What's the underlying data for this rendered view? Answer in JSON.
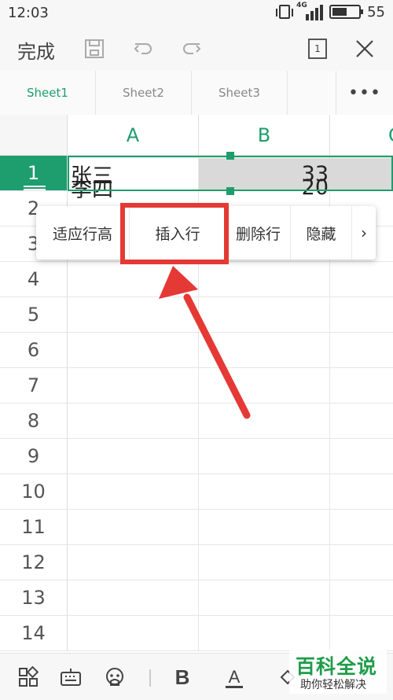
{
  "status_bar": {
    "time": "12:03",
    "network": "4G",
    "battery": "55",
    "battery_level": 0.55
  },
  "toolbar": {
    "done_label": "完成",
    "pages_count": "1"
  },
  "sheet_tabs": [
    "Sheet1",
    "Sheet2",
    "Sheet3"
  ],
  "more_tabs_label": "•••",
  "columns": [
    "A",
    "B",
    "C"
  ],
  "rows": [
    "1",
    "2",
    "3",
    "4",
    "5",
    "6",
    "7",
    "8",
    "9",
    "10",
    "11",
    "12",
    "13",
    "14"
  ],
  "cells": {
    "A1": "张三",
    "B1": "33",
    "A2": "李四",
    "B2": "20"
  },
  "context_menu": {
    "items": [
      "适应行高",
      "插入行",
      "删除行",
      "隐藏"
    ],
    "more_label": "›"
  },
  "colors": {
    "accent": "#1e9d6e",
    "highlight": "#e53935"
  },
  "watermark": {
    "title": "百科全说",
    "subtitle": "助你轻松解决"
  }
}
